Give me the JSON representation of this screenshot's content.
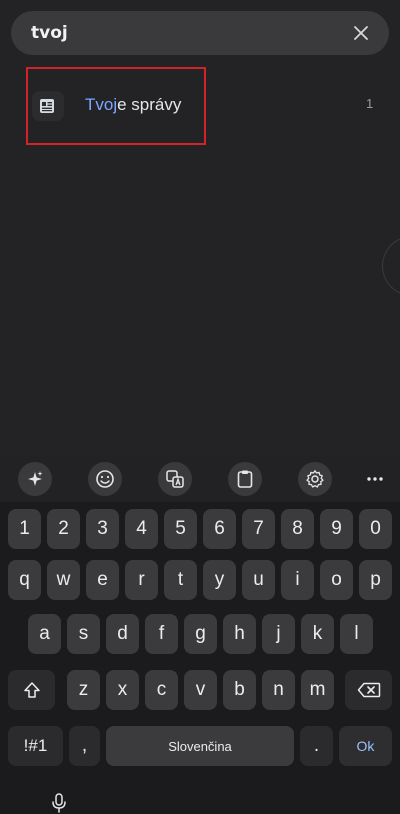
{
  "search": {
    "query": "tvoj"
  },
  "results": [
    {
      "highlight": "Tvoj",
      "rest": "e správy",
      "count": "1"
    }
  ],
  "keyboard": {
    "toolbar_icons": [
      "sparkle-icon",
      "emoji-icon",
      "translate-icon",
      "clipboard-icon",
      "gear-icon",
      "more-icon"
    ],
    "row_numbers": [
      "1",
      "2",
      "3",
      "4",
      "5",
      "6",
      "7",
      "8",
      "9",
      "0"
    ],
    "row_top": [
      "q",
      "w",
      "e",
      "r",
      "t",
      "y",
      "u",
      "i",
      "o",
      "p"
    ],
    "row_middle": [
      "a",
      "s",
      "d",
      "f",
      "g",
      "h",
      "j",
      "k",
      "l"
    ],
    "row_bottom": [
      "z",
      "x",
      "c",
      "v",
      "b",
      "n",
      "m"
    ],
    "symbols_label": "!#1",
    "comma_label": ",",
    "space_label": "Slovenčina",
    "period_label": ".",
    "ok_label": "Ok"
  },
  "colors": {
    "highlight": "#7aa7ff",
    "selection_border": "#d2232a"
  }
}
